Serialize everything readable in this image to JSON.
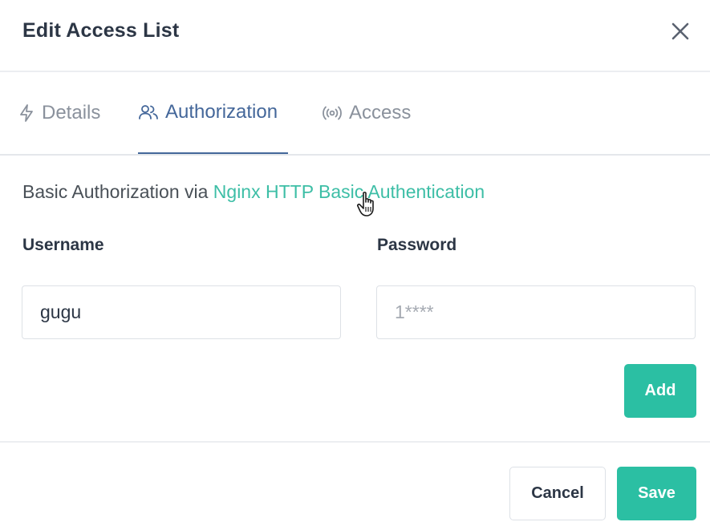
{
  "modal": {
    "title": "Edit Access List"
  },
  "tabs": [
    {
      "label": "Details",
      "icon": "lightning-icon",
      "active": false
    },
    {
      "label": "Authorization",
      "icon": "users-icon",
      "active": true
    },
    {
      "label": "Access",
      "icon": "broadcast-icon",
      "active": false
    }
  ],
  "intro": {
    "prefix": "Basic Authorization via ",
    "link_text": "Nginx HTTP Basic Authentication"
  },
  "form": {
    "username_label": "Username",
    "username_value": "gugu",
    "password_label": "Password",
    "password_placeholder": "1****",
    "add_label": "Add"
  },
  "footer": {
    "cancel_label": "Cancel",
    "save_label": "Save"
  },
  "colors": {
    "accent": "#2bbfa3",
    "link": "#3dbea6",
    "active_tab": "#44679a",
    "inactive_tab": "#8a919c"
  }
}
